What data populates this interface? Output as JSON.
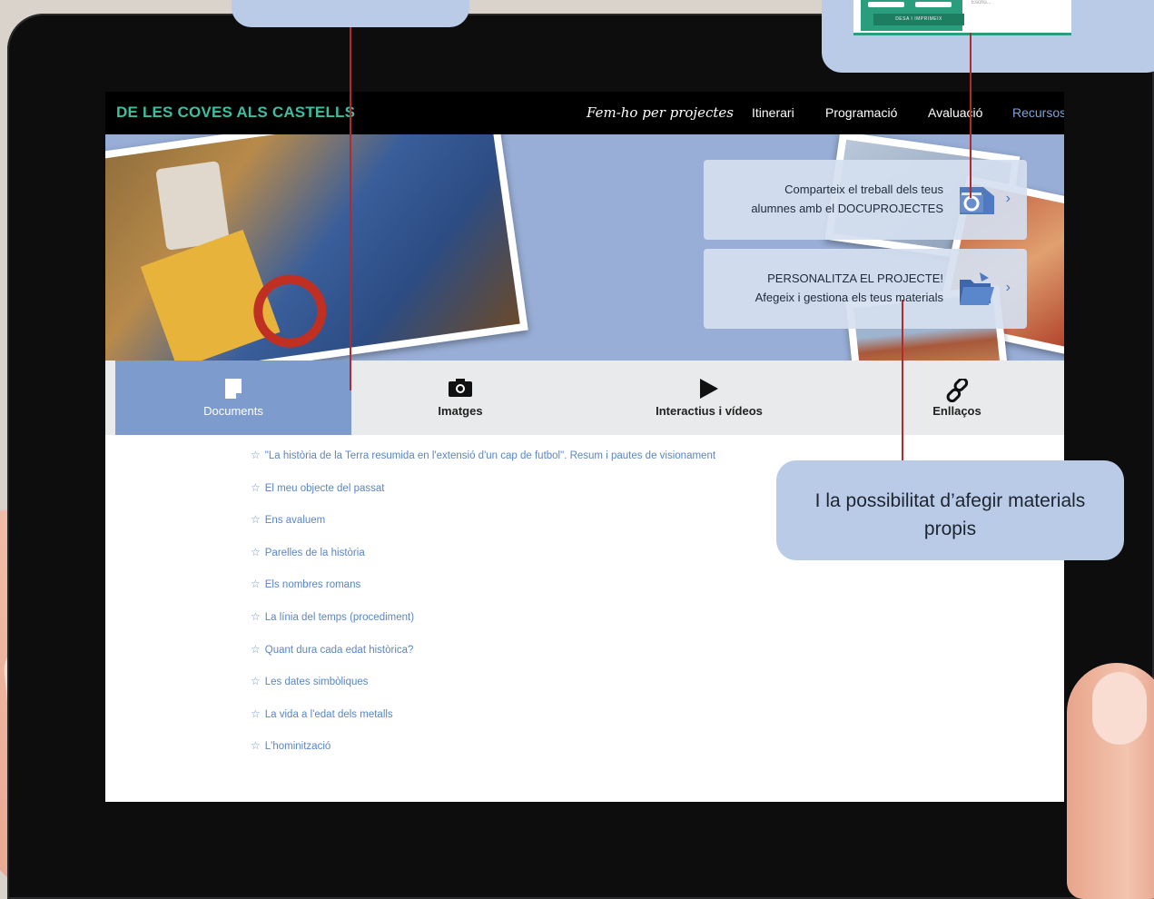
{
  "app": {
    "brand": "DE LES COVES ALS CASTELLS",
    "nav": [
      "Fem-ho per projectes",
      "Itinerari",
      "Programació",
      "Avaluació",
      "Recursos"
    ],
    "active_nav": "Recursos"
  },
  "cta": [
    {
      "line1": "Comparteix el treball dels teus",
      "line2": "alumnes amb el DOCUPROJECTES",
      "icon": "camera-icon"
    },
    {
      "line1": "PERSONALITZA EL PROJECTE!",
      "line2": "Afegeix i gestiona els teus materials",
      "icon": "folder-icon"
    }
  ],
  "tabs": [
    {
      "label": "Documents",
      "icon": "document-icon",
      "active": true
    },
    {
      "label": "Imatges",
      "icon": "camera-icon",
      "active": false
    },
    {
      "label": "Interactius i vídeos",
      "icon": "play-icon",
      "active": false
    },
    {
      "label": "Enllaços",
      "icon": "link-icon",
      "active": false
    }
  ],
  "documents": [
    "\"La història de la Terra resumida en l'extensió d'un cap de futbol\". Resum i pautes de visionament",
    "El meu objecte del passat",
    "Ens avaluem",
    "Parelles de la història",
    "Els nombres romans",
    "La línia del temps (procediment)",
    "Quant dura cada edat històrica?",
    "Les dates simbòliques",
    "La vida a l'edat dels metalls",
    "L'hominització"
  ],
  "callouts": {
    "bottom_right": "I la possibilitat d’afegir materials propis"
  },
  "thumbnail": {
    "button": "DESA I IMPRIMEIX",
    "field_hint": "Escriu..."
  },
  "colors": {
    "brand_green": "#3bbfa0",
    "active_blue": "#7d9bcc",
    "link_blue": "#5a85c4",
    "callout_bg": "#b9cbe6",
    "pointer_red": "#b12a2e"
  }
}
